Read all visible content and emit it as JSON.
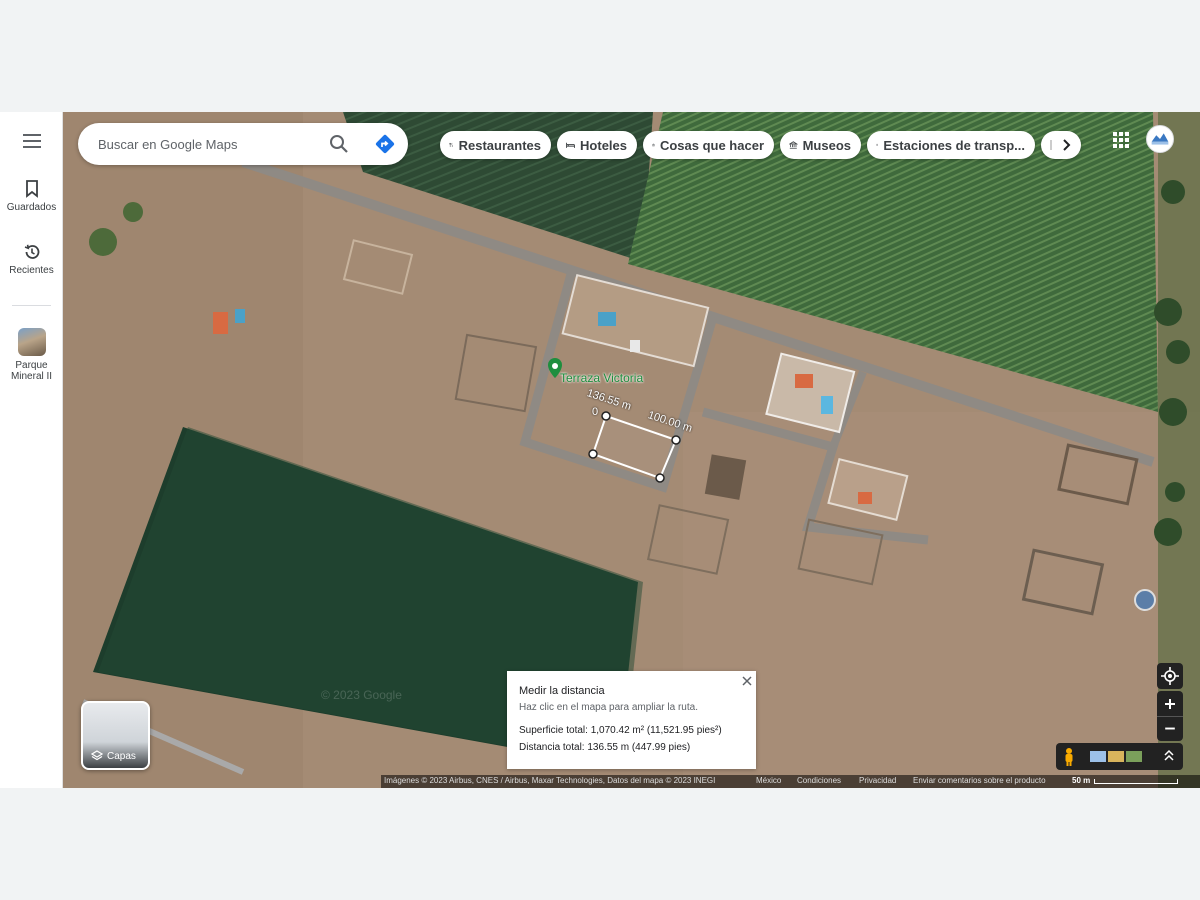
{
  "rail": {
    "menu_icon": "hamburger-menu-icon",
    "saved": {
      "label": "Guardados",
      "icon": "bookmark-icon"
    },
    "recent": {
      "label": "Recientes",
      "icon": "history-icon"
    },
    "place": {
      "label_line1": "Parque",
      "label_line2": "Mineral II"
    }
  },
  "search": {
    "placeholder": "Buscar en Google Maps",
    "search_icon": "search-icon",
    "directions_icon": "directions-icon"
  },
  "chips": [
    {
      "label": "Restaurantes",
      "icon": "fork-knife-icon"
    },
    {
      "label": "Hoteles",
      "icon": "bed-icon"
    },
    {
      "label": "Cosas que hacer",
      "icon": "camera-icon"
    },
    {
      "label": "Museos",
      "icon": "museum-icon"
    },
    {
      "label": "Estaciones de transp...",
      "icon": "transit-icon"
    }
  ],
  "chips_more_icon": "chevron-right-icon",
  "map": {
    "place_label": "Terraza Victoria",
    "watermark": "© 2023 Google",
    "measure_labels": {
      "side_a": "136.55 m",
      "side_b": "100.00 m",
      "side_c": "0"
    }
  },
  "measure": {
    "title": "Medir la distancia",
    "subtitle": "Haz clic en el mapa para ampliar la ruta.",
    "area": "Superficie total: 1,070.42 m² (11,521.95 pies²)",
    "distance": "Distancia total: 136.55 m (447.99 pies)"
  },
  "layers": {
    "label": "Capas"
  },
  "footer": {
    "imagery": "Imágenes © 2023 Airbus, CNES / Airbus, Maxar Technologies, Datos del mapa © 2023 INEGI",
    "country": "México",
    "terms": "Condiciones",
    "privacy": "Privacidad",
    "feedback": "Enviar comentarios sobre el producto",
    "scale": "50 m"
  },
  "colors": {
    "accent": "#1a73e8",
    "place_green": "#1e8e3e",
    "field": "#1d3d2c",
    "ground": "#a48b74"
  }
}
